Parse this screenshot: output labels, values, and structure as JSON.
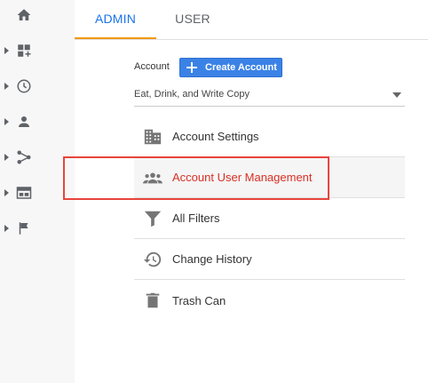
{
  "leftnav": {
    "items": [
      {
        "icon": "home-icon"
      },
      {
        "icon": "customization-icon"
      },
      {
        "icon": "realtime-clock-icon"
      },
      {
        "icon": "audience-person-icon"
      },
      {
        "icon": "acquisition-icon"
      },
      {
        "icon": "behavior-icon"
      },
      {
        "icon": "conversions-flag-icon"
      }
    ]
  },
  "tabs": [
    {
      "label": "ADMIN",
      "active": true
    },
    {
      "label": "USER",
      "active": false
    }
  ],
  "account": {
    "label": "Account",
    "create_label": "Create Account",
    "selected": "Eat, Drink, and Write Copy"
  },
  "menu": [
    {
      "label": "Account Settings",
      "icon": "building-icon"
    },
    {
      "label": "Account User Management",
      "icon": "users-icon",
      "highlighted": true
    },
    {
      "label": "All Filters",
      "icon": "filter-icon"
    },
    {
      "label": "Change History",
      "icon": "history-icon"
    },
    {
      "label": "Trash Can",
      "icon": "trash-icon"
    }
  ],
  "colors": {
    "accent": "#1a73e8",
    "tab_underline": "#f29900",
    "highlight": "#e8453c",
    "button": "#3b82e6"
  }
}
